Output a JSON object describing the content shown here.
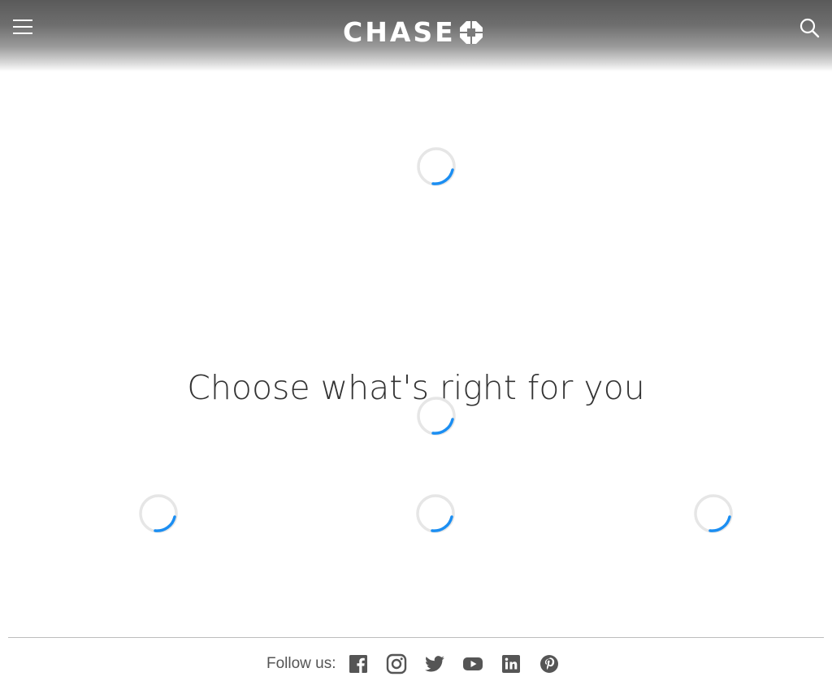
{
  "header": {
    "brand": "CHASE",
    "menu_icon": "hamburger-menu-icon",
    "search_icon": "search-icon",
    "logo_mark_icon": "chase-octagon-icon"
  },
  "main": {
    "headline": "Choose what's right for you",
    "loading_indicators": 5
  },
  "footer": {
    "follow_label": "Follow us:",
    "social": [
      {
        "name": "facebook",
        "icon": "facebook-icon"
      },
      {
        "name": "instagram",
        "icon": "instagram-icon"
      },
      {
        "name": "twitter",
        "icon": "twitter-icon"
      },
      {
        "name": "youtube",
        "icon": "youtube-icon"
      },
      {
        "name": "linkedin",
        "icon": "linkedin-icon"
      },
      {
        "name": "pinterest",
        "icon": "pinterest-icon"
      }
    ]
  },
  "colors": {
    "header_dark": "#5a5a5a",
    "spinner_track": "#e6e6e6",
    "spinner_arc": "#1b8ef2",
    "headline_text": "#333333",
    "icon_gray": "#555555"
  }
}
